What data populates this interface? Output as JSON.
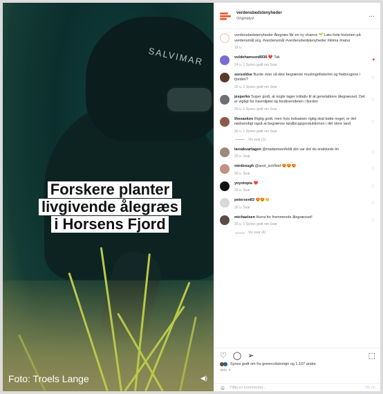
{
  "media": {
    "headline_lines": [
      "Forskere planter",
      "livgivende ålegræs",
      "i Horsens Fjord"
    ],
    "suit_text": "SALVIMAR",
    "credit": "Foto: Troels Lange"
  },
  "header": {
    "account": "verdensbedstenyheder",
    "subtitle": "Originalyd",
    "more": "···"
  },
  "caption": {
    "text": "verdensbedstenyheder Ålegræs får en ny chance 🌱 Læs hele historien på verdensmål.org. #verdensmål #verdensbedstenyheder #klima #natur",
    "meta": "19 u."
  },
  "comments": [
    {
      "user": "voldehamsen8936",
      "text": "❤️ Tak",
      "meta": "24 u.   1 Synes godt om   Svar",
      "liked": true
    },
    {
      "user": "sorsoldse",
      "text": "Burde man så ikke begrænse muslingefiskeriet og fiskbrugene i fjorden?",
      "meta": "20 u.   2 Synes godt om   Svar",
      "liked": false
    },
    {
      "user": "jesperko",
      "text": "Super godt, at nogle tager initiativ til at genetablere ålegræsset. Det er vigtigt for havmiljøet og biodiversiteten i fjorden",
      "meta": "20 u.   1 Synes godt om   Svar",
      "liked": false
    },
    {
      "user": "theoaskov",
      "text": "Rigtig godt, men hvis indsatsen rigtig skal batte noget, er det nødvendigt også at begrænse landbrugsproduktionen i det store land",
      "meta": "20 u.   1 Synes godt om   Svar",
      "liked": false
    },
    {
      "user": "larsakvartagen",
      "text": "@madamsenfeldt det var det du snakkede lm",
      "meta": "20 u.   Svar",
      "liked": false
    },
    {
      "user": "minibough",
      "text": "@anol_schfleid 😍😍😍",
      "meta": "20 u.   Svar",
      "liked": false
    },
    {
      "user": "yoyotopia",
      "text": "❤️",
      "meta": "20 u.   Svar",
      "liked": false
    },
    {
      "user": "petersen83",
      "text": "😍😍👏",
      "meta": "20 u.   Svar",
      "liked": false
    },
    {
      "user": "michaelsen",
      "text": "Hurra for fremmende ålegræsset!",
      "meta": "20 u.   1 Synes godt om   Svar",
      "liked": false
    }
  ],
  "replies_labels": [
    "Vis svar (1)",
    "Vis svar (4)"
  ],
  "actions": {
    "likes_text": "Synes godt om fra greencolatoriqin og 1.107 andre",
    "date": "uhfo. 4",
    "add_comment_placeholder": "Tilføj en kommentar...",
    "post_label": "Slå op"
  },
  "colors": {
    "accent": "#e8643c",
    "like_red": "#e0245e",
    "post_blue": "#b3d4f5"
  }
}
